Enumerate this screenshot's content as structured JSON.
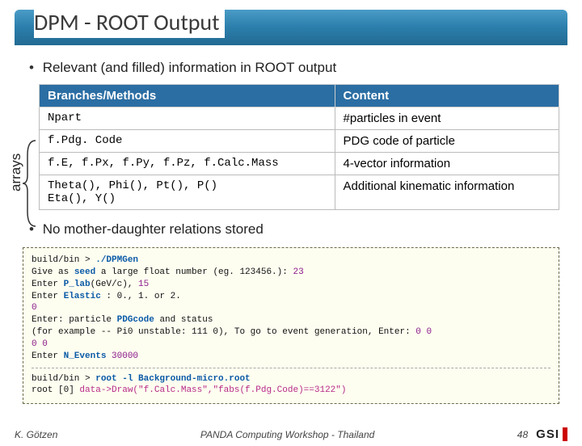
{
  "title": "DPM - ROOT Output",
  "bullet1": "Relevant (and filled) information in ROOT output",
  "table": {
    "headers": {
      "col1": "Branches/Methods",
      "col2": "Content"
    },
    "rows": [
      {
        "c1": "Npart",
        "c2": "#particles in event"
      },
      {
        "c1": "f.Pdg. Code",
        "c2": "PDG code of particle"
      },
      {
        "c1": "f.E, f.Px, f.Py, f.Pz, f.Calc.Mass",
        "c2": "4-vector information"
      },
      {
        "c1": "Theta(), Phi(), Pt(), P()\nEta(), Y()",
        "c2": "Additional kinematic information"
      }
    ]
  },
  "arrays_label": "arrays",
  "bullet2": "No mother-daughter relations stored",
  "code": {
    "l1a": "build/bin > ",
    "l1b": "./DPMGen",
    "l2a": "Give as ",
    "l2b": "seed",
    "l2c": " a large float number (eg. 123456.): ",
    "l2d": "23",
    "l3a": "Enter  ",
    "l3b": "P_lab",
    "l3c": "(GeV/c), ",
    "l3d": "15",
    "l4a": "Enter  ",
    "l4b": "Elastic",
    "l4c": " : 0., 1. or 2.",
    "l5": "0",
    "l6a": "Enter:  particle ",
    "l6b": "PDGcode",
    "l6c": " and status",
    "l7a": "  (for example -- Pi0 unstable:  111  0), To go to event generation, Enter:  ",
    "l7b": "0  0",
    "l8": "0 0",
    "l9a": "Enter  ",
    "l9b": "N_Events",
    "l9c": " ",
    "l9d": "30000",
    "l10a": "build/bin > ",
    "l10b": "root -l Background-micro.root",
    "l11a": "root [0] ",
    "l11b": "data->Draw(\"f.Calc.Mass\",\"fabs(f.Pdg.Code)==3122\")"
  },
  "footer": {
    "author": "K. Götzen",
    "venue": "PANDA Computing Workshop - Thailand",
    "page": "48",
    "logo": "GSI"
  }
}
